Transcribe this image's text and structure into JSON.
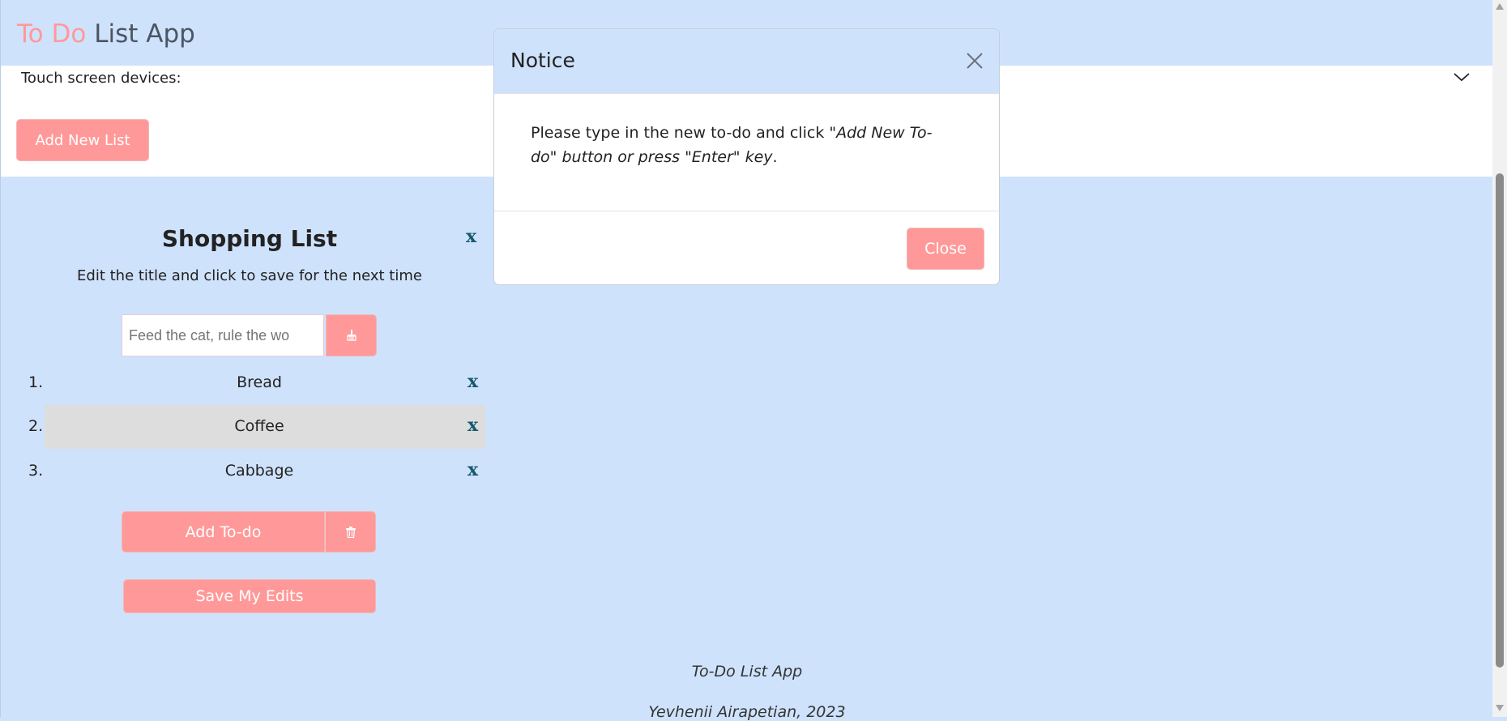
{
  "header": {
    "brand_part1": "To Do",
    "brand_part2": "List App"
  },
  "touch": {
    "label": "Touch screen devices:",
    "toggle_icon": "chevron-down-icon"
  },
  "toolbar": {
    "add_new_list_label": "Add New List"
  },
  "list": {
    "title": "Shopping List",
    "remove_label": "x",
    "subtitle": "Edit the title and click to save for the next time",
    "input_placeholder": "Feed the cat, rule the wo",
    "clear_icon": "broom-icon",
    "items": [
      {
        "number": "1.",
        "text": "Bread",
        "delete_label": "x",
        "highlighted": false
      },
      {
        "number": "2.",
        "text": "Coffee",
        "delete_label": "x",
        "highlighted": true
      },
      {
        "number": "3.",
        "text": "Cabbage",
        "delete_label": "x",
        "highlighted": false
      }
    ],
    "add_todo_label": "Add To-do",
    "trash_icon": "trash-icon",
    "save_edits_label": "Save My Edits"
  },
  "footer": {
    "line1": "To-Do List App",
    "line2": "Yevhenii Airapetian, 2023"
  },
  "modal": {
    "title": "Notice",
    "body_start": "Please type in the new to-do and click ",
    "body_em1": "\"Add New To-do\"",
    "body_em2": "button or press \"Enter\" key",
    "body_end": ".",
    "close_label": "Close"
  },
  "colors": {
    "accent": "#ff9999",
    "page_bg": "#cfe2fc",
    "delete_x": "#155a6e",
    "highlight_row": "#dddddd"
  }
}
